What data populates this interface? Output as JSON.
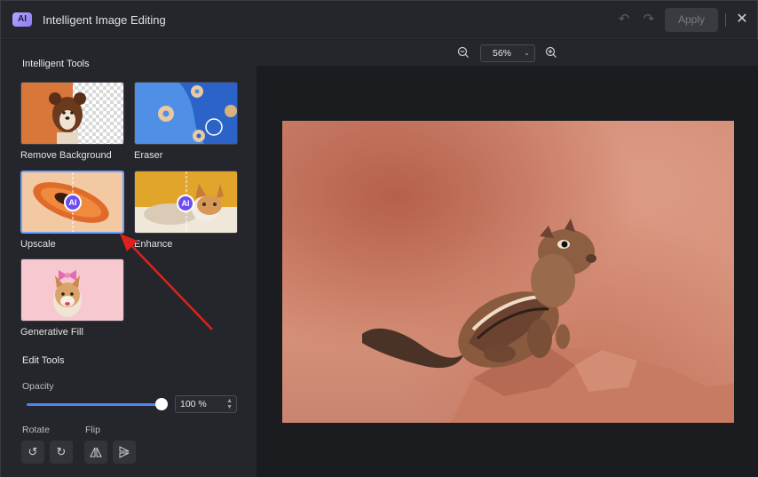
{
  "titlebar": {
    "logo_text": "AI",
    "title": "Intelligent Image Editing",
    "apply_label": "Apply",
    "undo_icon": "undo-icon",
    "redo_icon": "redo-icon",
    "close_icon": "close-icon"
  },
  "intelligent_tools": {
    "heading": "Intelligent Tools",
    "items": [
      {
        "label": "Remove Background",
        "badge": ""
      },
      {
        "label": "Eraser",
        "badge": ""
      },
      {
        "label": "Upscale",
        "badge": "AI",
        "selected": true
      },
      {
        "label": "Enhance",
        "badge": "AI"
      },
      {
        "label": "Generative Fill",
        "badge": ""
      }
    ]
  },
  "edit_tools": {
    "heading": "Edit Tools",
    "opacity_label": "Opacity",
    "opacity_value": "100 %",
    "opacity_level": 1.0,
    "rotate_label": "Rotate",
    "flip_label": "Flip"
  },
  "canvas": {
    "zoom_value": "56%",
    "zoom_out_icon": "zoom-out-icon",
    "zoom_in_icon": "zoom-in-icon"
  },
  "colors": {
    "accent": "#4a86f7",
    "ai_badge": "#6d4df0",
    "annotation_arrow": "#e0201c"
  }
}
